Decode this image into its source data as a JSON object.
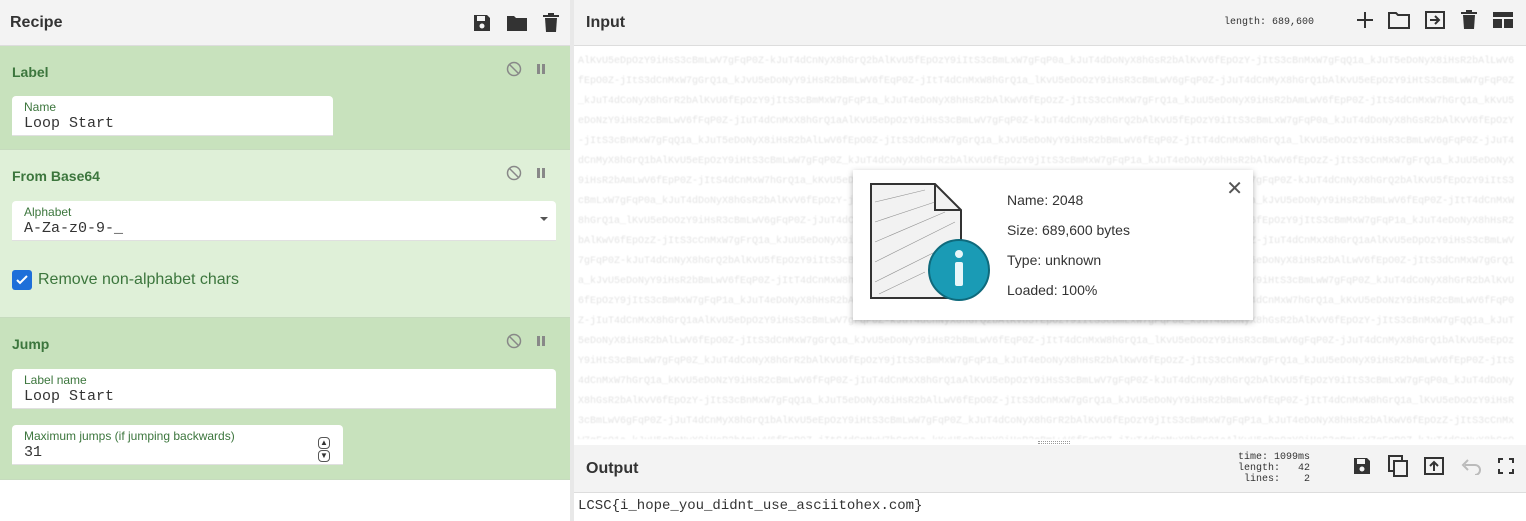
{
  "recipe": {
    "title": "Recipe",
    "operations": {
      "label": {
        "title": "Label",
        "name_label": "Name",
        "name_value": "Loop Start"
      },
      "from_base64": {
        "title": "From Base64",
        "alphabet_label": "Alphabet",
        "alphabet_value": "A-Za-z0-9-_",
        "remove_label": "Remove non-alphabet chars",
        "remove_checked": true
      },
      "jump": {
        "title": "Jump",
        "label_name_label": "Label name",
        "label_name_value": "Loop Start",
        "max_jumps_label": "Maximum jumps (if jumping backwards)",
        "max_jumps_value": "31"
      }
    }
  },
  "input": {
    "title": "Input",
    "length_text": "length: 689,600",
    "file": {
      "name": "Name: 2048",
      "size": "Size: 689,600 bytes",
      "type": "Type: unknown",
      "loaded": "Loaded: 100%"
    }
  },
  "output": {
    "title": "Output",
    "stats": "time: 1099ms\nlength:   42\n lines:    2",
    "text": "LCSC{i_hope_you_didnt_use_asciitohex.com}"
  },
  "colors": {
    "op_active": "#c8e2bd",
    "op_light": "#dff0d8",
    "accent_green": "#3c763d",
    "checkbox_blue": "#1e6fd9",
    "info_teal": "#1a9bb5"
  }
}
